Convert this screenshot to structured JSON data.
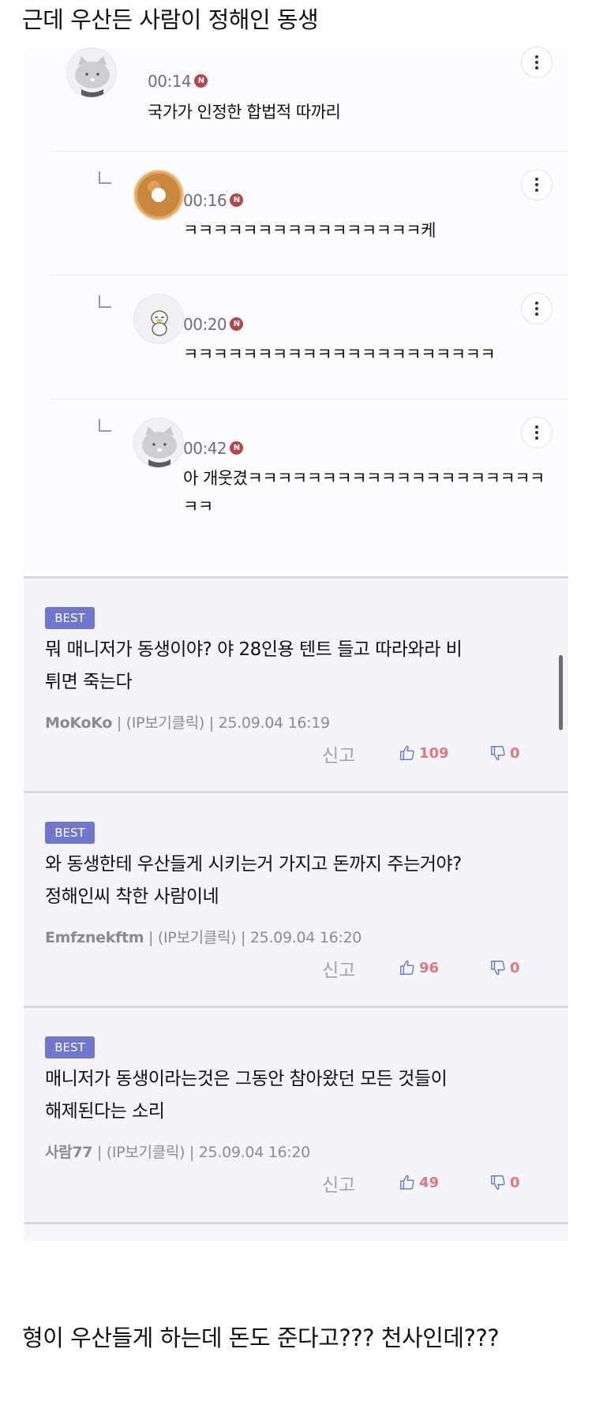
{
  "headings": {
    "top": "근데 우산든 사람이 정해인 동생",
    "bottom": "형이 우산들게 하는데 돈도 준다고??? 천사인데???"
  },
  "replies": [
    {
      "time": "00:14",
      "badge": "N",
      "text": "국가가 인정한 합법적 따까리",
      "avatar": "cat-avatar"
    },
    {
      "time": "00:16",
      "badge": "N",
      "text": "ㅋㅋㅋㅋㅋㅋㅋㅋㅋㅋㅋㅋㅋㅋㅋㅋ케",
      "avatar": "donut-avatar"
    },
    {
      "time": "00:20",
      "badge": "N",
      "text": "ㅋㅋㅋㅋㅋㅋㅋㅋㅋㅋㅋㅋㅋㅋㅋㅋㅋㅋㅋㅋㅋ",
      "avatar": "duck-avatar"
    },
    {
      "time": "00:42",
      "badge": "N",
      "text_line1": "아 개웃겼ㅋㅋㅋㅋㅋㅋㅋㅋㅋㅋㅋㅋㅋㅋㅋㅋㅋㅋㅋㅋ",
      "text_line2": "ㅋㅋ",
      "avatar": "cat-avatar"
    }
  ],
  "best_comments": [
    {
      "badge": "BEST",
      "text": "뭐 매니저가 동생이야? 야 28인용 텐트 들고 따라와라 비\n튀면 죽는다",
      "user": "MoKoKo",
      "meta": " | (IP보기클릭) | 25.09.04 16:19",
      "report": "신고",
      "likes": "109",
      "dislikes": "0"
    },
    {
      "badge": "BEST",
      "text": "와 동생한테 우산들게 시키는거 가지고 돈까지 주는거야?\n정해인씨 착한 사람이네",
      "user": "Emfznekftm",
      "meta": " | (IP보기클릭) | 25.09.04 16:20",
      "report": "신고",
      "likes": "96",
      "dislikes": "0"
    },
    {
      "badge": "BEST",
      "text": "매니저가 동생이라는것은   그동안 참아왔던 모든 것들이\n해제된다는 소리",
      "user": "사람77",
      "meta": " | (IP보기클릭) | 25.09.04 16:20",
      "report": "신고",
      "likes": "49",
      "dislikes": "0"
    }
  ],
  "colors": {
    "best_badge": "#7077cf",
    "new_badge": "#b8454c",
    "vote": "#e0787f"
  }
}
